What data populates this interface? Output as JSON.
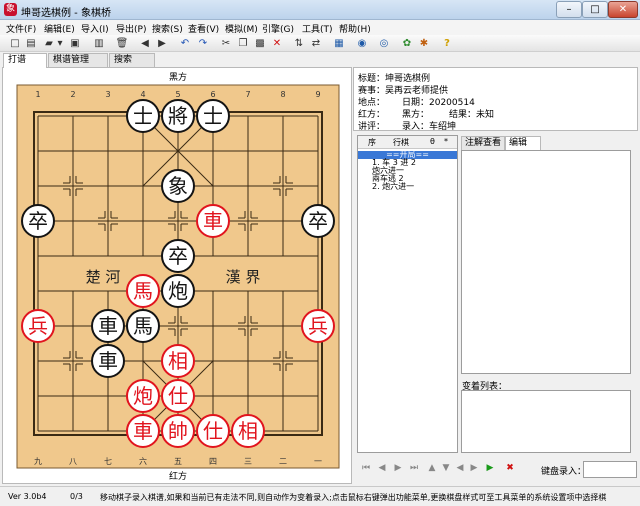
{
  "window": {
    "title": "坤哥选棋例 - 象棋桥",
    "min": "–",
    "max": "□",
    "close": "✕"
  },
  "menu": [
    "文件(F)",
    "编辑(E)",
    "导入(I)",
    "导出(P)",
    "搜索(S)",
    "查看(V)",
    "模拟(M)",
    "引擎(G)",
    "工具(T)",
    "帮助(H)"
  ],
  "toolbar": [
    {
      "icon": "new-file-icon",
      "glyph": "□"
    },
    {
      "icon": "save-db-icon",
      "glyph": "▤"
    },
    {
      "icon": "open-folder-icon",
      "glyph": "▰"
    },
    {
      "icon": "open-dropdown-icon",
      "glyph": "▾"
    },
    {
      "icon": "save-icon",
      "glyph": "▣"
    },
    {
      "icon": "delete-doc-icon",
      "glyph": "▥"
    },
    {
      "icon": "trash-icon",
      "glyph": "🗑"
    },
    {
      "icon": "back-icon",
      "glyph": "◀"
    },
    {
      "icon": "forward-icon",
      "glyph": "▶"
    },
    {
      "icon": "undo-icon",
      "glyph": "↶"
    },
    {
      "icon": "redo-icon",
      "glyph": "↷"
    },
    {
      "icon": "cut-icon",
      "glyph": "✂"
    },
    {
      "icon": "copy-icon",
      "glyph": "❐"
    },
    {
      "icon": "paste-icon",
      "glyph": "▩"
    },
    {
      "icon": "delete-icon",
      "glyph": "✕"
    },
    {
      "icon": "flip-vertical-icon",
      "glyph": "⇅"
    },
    {
      "icon": "flip-horizontal-icon",
      "glyph": "⇄"
    },
    {
      "icon": "board-view-icon",
      "glyph": "▦"
    },
    {
      "icon": "record-icon",
      "glyph": "◉"
    },
    {
      "icon": "engine-icon",
      "glyph": "◎"
    },
    {
      "icon": "analyze-icon",
      "glyph": "✿"
    },
    {
      "icon": "settings-icon",
      "glyph": "✱"
    },
    {
      "icon": "help-icon",
      "glyph": "?"
    }
  ],
  "tabs": [
    "打谱",
    "棋谱管理",
    "搜索"
  ],
  "board": {
    "top_label": "黑方",
    "bottom_label": "红方",
    "top_numbers": [
      "1",
      "2",
      "3",
      "4",
      "5",
      "6",
      "7",
      "8",
      "9"
    ],
    "bottom_numbers": [
      "九",
      "八",
      "七",
      "六",
      "五",
      "四",
      "三",
      "二",
      "一"
    ],
    "river_left": "楚  河",
    "river_right": "漢  界"
  },
  "pieces": [
    {
      "color": "black",
      "char": "士",
      "file": 3,
      "rank": 0
    },
    {
      "color": "black",
      "char": "將",
      "file": 4,
      "rank": 0
    },
    {
      "color": "black",
      "char": "士",
      "file": 5,
      "rank": 0
    },
    {
      "color": "black",
      "char": "象",
      "file": 4,
      "rank": 2
    },
    {
      "color": "black",
      "char": "卒",
      "file": 0,
      "rank": 3
    },
    {
      "color": "red",
      "char": "車",
      "file": 5,
      "rank": 3
    },
    {
      "color": "black",
      "char": "卒",
      "file": 8,
      "rank": 3
    },
    {
      "color": "black",
      "char": "卒",
      "file": 4,
      "rank": 4
    },
    {
      "color": "red",
      "char": "馬",
      "file": 3,
      "rank": 5
    },
    {
      "color": "black",
      "char": "炮",
      "file": 4,
      "rank": 5
    },
    {
      "color": "red",
      "char": "兵",
      "file": 0,
      "rank": 6
    },
    {
      "color": "black",
      "char": "車",
      "file": 2,
      "rank": 6
    },
    {
      "color": "black",
      "char": "馬",
      "file": 3,
      "rank": 6
    },
    {
      "color": "red",
      "char": "兵",
      "file": 8,
      "rank": 6
    },
    {
      "color": "black",
      "char": "車",
      "file": 2,
      "rank": 7
    },
    {
      "color": "red",
      "char": "相",
      "file": 4,
      "rank": 7
    },
    {
      "color": "red",
      "char": "炮",
      "file": 3,
      "rank": 8
    },
    {
      "color": "red",
      "char": "仕",
      "file": 4,
      "rank": 8
    },
    {
      "color": "red",
      "char": "車",
      "file": 3,
      "rank": 9
    },
    {
      "color": "red",
      "char": "帥",
      "file": 4,
      "rank": 9
    },
    {
      "color": "red",
      "char": "仕",
      "file": 5,
      "rank": 9
    },
    {
      "color": "red",
      "char": "相",
      "file": 6,
      "rank": 9
    }
  ],
  "info": {
    "title": "标题：坤哥选棋例",
    "event": "赛事：吴再云老师提供",
    "site": "地点：",
    "date": "日期：20200514",
    "red": "红方：",
    "black": "黑方：",
    "result": "结果：未知",
    "commentator": "讲评：",
    "recorder": "录入：车绍坤"
  },
  "moves": {
    "headers": [
      "序",
      "行棋",
      "θ",
      "*"
    ],
    "rows": [
      "==开局==",
      "1.  车 3 进 2",
      "    炮六进一",
      "    兩车逃 2",
      "2.  炮六进一"
    ]
  },
  "right_tabs": [
    "注解查看",
    "编辑"
  ],
  "variation_label": "变着列表：",
  "nav": {
    "buttons": [
      {
        "icon": "first-move-icon",
        "glyph": "⏮"
      },
      {
        "icon": "prev-move-icon",
        "glyph": "◀"
      },
      {
        "icon": "next-move-icon",
        "glyph": "▶"
      },
      {
        "icon": "last-move-icon",
        "glyph": "⏭"
      },
      {
        "icon": "up-icon",
        "glyph": "▲"
      },
      {
        "icon": "down-icon",
        "glyph": "▼"
      },
      {
        "icon": "left-icon",
        "glyph": "◀"
      },
      {
        "icon": "right-icon",
        "glyph": "▶"
      },
      {
        "icon": "play-icon",
        "glyph": "▶"
      },
      {
        "icon": "stop-icon",
        "glyph": "✖"
      }
    ],
    "record_label": "键盘录入："
  },
  "status": {
    "version": "Ver 3.0b4",
    "position": "0/3",
    "message": "移动棋子录入棋谱,如果和当前已有走法不同,则自动作为变着录入;点击鼠标右键弹出功能菜单,更换棋盘样式可至工具菜单的系统设置项中选择棋"
  },
  "colors": {
    "board": "#f0c88c",
    "red": "#e1141e",
    "black": "#141414"
  }
}
